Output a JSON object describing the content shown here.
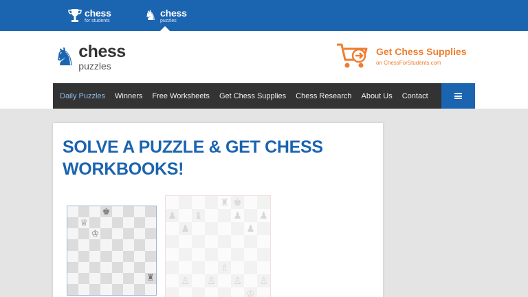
{
  "topbar": {
    "sites": [
      {
        "name": "chess",
        "sub": "for students",
        "icon": "trophy-icon"
      },
      {
        "name": "chess",
        "sub": "puzzles",
        "icon": "knight-icon"
      }
    ]
  },
  "header": {
    "logo": {
      "line1": "chess",
      "line2": "puzzles",
      "icon": "knight-icon"
    },
    "supplies": {
      "title": "Get Chess Supplies",
      "subtitle": "on ChessForStudents.com",
      "icon": "shopping-cart-icon"
    }
  },
  "nav": {
    "items": [
      {
        "label": "Daily Puzzles",
        "active": true
      },
      {
        "label": "Winners",
        "active": false
      },
      {
        "label": "Free Worksheets",
        "active": false
      },
      {
        "label": "Get Chess Supplies",
        "active": false
      },
      {
        "label": "Chess Research",
        "active": false
      },
      {
        "label": "About Us",
        "active": false
      },
      {
        "label": "Contact",
        "active": false
      }
    ],
    "menu_icon": "hamburger-icon"
  },
  "main": {
    "heading": "SOLVE A PUZZLE & GET CHESS WORKBOOKS!",
    "board1": {
      "pieces": [
        {
          "glyph": "♚",
          "row": 0,
          "col": 3,
          "name": "black-king"
        },
        {
          "glyph": "♕",
          "row": 1,
          "col": 1,
          "name": "white-queen"
        },
        {
          "glyph": "♔",
          "row": 2,
          "col": 2,
          "name": "white-king"
        },
        {
          "glyph": "♜",
          "row": 6,
          "col": 7,
          "name": "black-rook"
        }
      ]
    },
    "board2": {
      "pieces": [
        {
          "glyph": "♜",
          "row": 0,
          "col": 4,
          "name": "black-rook"
        },
        {
          "glyph": "♚",
          "row": 0,
          "col": 5,
          "name": "black-king"
        },
        {
          "glyph": "♟",
          "row": 1,
          "col": 0,
          "name": "black-pawn"
        },
        {
          "glyph": "♝",
          "row": 1,
          "col": 2,
          "name": "black-bishop"
        },
        {
          "glyph": "♟",
          "row": 1,
          "col": 5,
          "name": "black-pawn"
        },
        {
          "glyph": "♟",
          "row": 1,
          "col": 7,
          "name": "black-pawn"
        },
        {
          "glyph": "♟",
          "row": 2,
          "col": 1,
          "name": "black-pawn"
        },
        {
          "glyph": "♟",
          "row": 2,
          "col": 6,
          "name": "black-pawn"
        },
        {
          "glyph": "♗",
          "row": 5,
          "col": 4,
          "name": "white-bishop"
        },
        {
          "glyph": "♙",
          "row": 6,
          "col": 1,
          "name": "white-pawn"
        },
        {
          "glyph": "♙",
          "row": 6,
          "col": 3,
          "name": "white-pawn"
        },
        {
          "glyph": "♙",
          "row": 6,
          "col": 5,
          "name": "white-pawn"
        },
        {
          "glyph": "♙",
          "row": 6,
          "col": 7,
          "name": "white-pawn"
        },
        {
          "glyph": "♔",
          "row": 7,
          "col": 6,
          "name": "white-king"
        }
      ]
    }
  },
  "colors": {
    "brand_blue": "#1b64b0",
    "accent_orange": "#ee7d2f",
    "nav_bg": "#333333"
  }
}
